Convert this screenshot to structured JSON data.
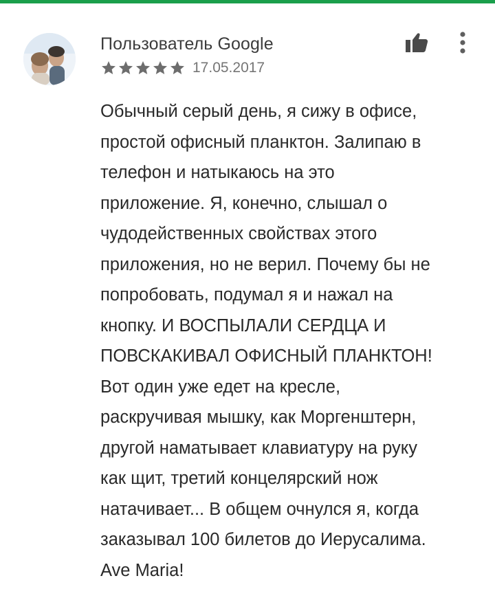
{
  "colors": {
    "accent_bar": "#1a9f4b",
    "star": "#6d6d6d",
    "text": "#2a2a2a",
    "muted": "#757575"
  },
  "review": {
    "author": "Пользователь Google",
    "avatar_icon": "user-photo-avatar",
    "rating": 5,
    "rating_max": 5,
    "date": "17.05.2017",
    "actions": {
      "helpful_icon": "thumb-up-icon",
      "more_icon": "more-vert-icon"
    },
    "text_lines": [
      "Обычный серый день, я сижу в офисе,",
      "простой офисный планктон. Залипаю в",
      "телефон и натыкаюсь на это",
      "приложение. Я, конечно, слышал о",
      "чудодейственных свойствах этого",
      "приложения, но не верил. Почему бы не",
      "попробовать, подумал я и нажал на",
      "кнопку. И ВОСПЫЛАЛИ СЕРДЦА И",
      "ПОВСКАКИВАЛ ОФИСНЫЙ ПЛАНКТОН!",
      "Вот один уже едет на кресле,",
      "раскручивая мышку, как Моргенштерн,",
      "другой наматывает клавиатуру на руку",
      "как щит, третий концелярский нож",
      "натачивает... В общем очнулся я, когда",
      "заказывал 100 билетов до Иерусалима.",
      "Ave Maria!"
    ]
  }
}
